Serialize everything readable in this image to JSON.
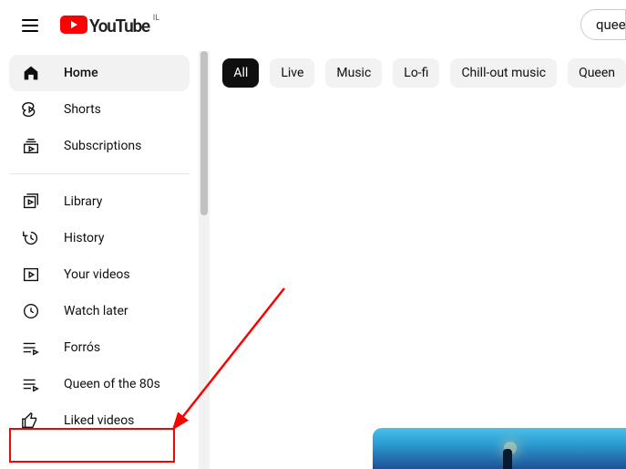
{
  "header": {
    "brand_text": "YouTube",
    "region_code": "IL",
    "search_value": "queen"
  },
  "sidebar": {
    "items": [
      {
        "label": "Home",
        "icon": "home",
        "active": true
      },
      {
        "label": "Shorts",
        "icon": "shorts",
        "active": false
      },
      {
        "label": "Subscriptions",
        "icon": "subscriptions",
        "active": false
      }
    ],
    "library_items": [
      {
        "label": "Library",
        "icon": "library"
      },
      {
        "label": "History",
        "icon": "history"
      },
      {
        "label": "Your videos",
        "icon": "your-videos"
      },
      {
        "label": "Watch later",
        "icon": "watch-later"
      },
      {
        "label": "Forrós",
        "icon": "playlist"
      },
      {
        "label": "Queen of the 80s",
        "icon": "playlist"
      },
      {
        "label": "Liked videos",
        "icon": "liked"
      }
    ]
  },
  "chips": [
    {
      "label": "All",
      "selected": true
    },
    {
      "label": "Live",
      "selected": false
    },
    {
      "label": "Music",
      "selected": false
    },
    {
      "label": "Lo-fi",
      "selected": false
    },
    {
      "label": "Chill-out music",
      "selected": false
    },
    {
      "label": "Queen",
      "selected": false
    }
  ],
  "annotation": {
    "highlight_target_label": "Queen of the 80s"
  }
}
